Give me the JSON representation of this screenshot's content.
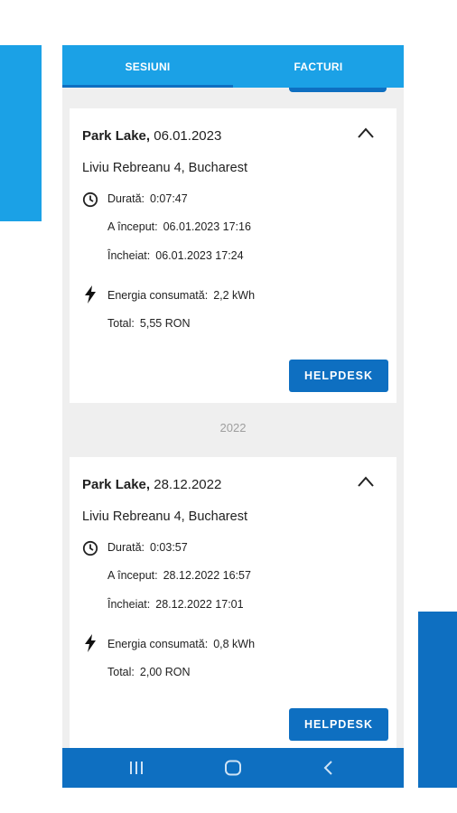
{
  "tabs": [
    {
      "label": "SESIUNI"
    },
    {
      "label": "FACTURI"
    }
  ],
  "sessions": [
    {
      "location": "Park Lake,",
      "date": "06.01.2023",
      "address": "Liviu Rebreanu 4, Bucharest",
      "duration_label": "Durată:",
      "duration": "0:07:47",
      "started_label": "A început:",
      "started": "06.01.2023 17:16",
      "ended_label": "Încheiat:",
      "ended": "06.01.2023 17:24",
      "energy_label": "Energia consumată:",
      "energy": "2,2 kWh",
      "total_label": "Total:",
      "total": "5,55 RON",
      "button": "HELPDESK"
    },
    {
      "location": "Park Lake,",
      "date": "28.12.2022",
      "address": "Liviu Rebreanu 4, Bucharest",
      "duration_label": "Durată:",
      "duration": "0:03:57",
      "started_label": "A început:",
      "started": "28.12.2022 16:57",
      "ended_label": "Încheiat:",
      "ended": "28.12.2022 17:01",
      "energy_label": "Energia consumată:",
      "energy": "0,8 kWh",
      "total_label": "Total:",
      "total": "2,00 RON",
      "button": "HELPDESK"
    }
  ],
  "year_separator": "2022",
  "icons": {
    "collapse": "chevron-up-icon",
    "duration": "clock-icon",
    "energy": "lightning-icon",
    "nav": [
      "recent-apps-icon",
      "home-icon",
      "back-icon"
    ]
  },
  "colors": {
    "tab_bar": "#1ba1e6",
    "primary": "#0e6fc1",
    "background": "#efefef"
  }
}
